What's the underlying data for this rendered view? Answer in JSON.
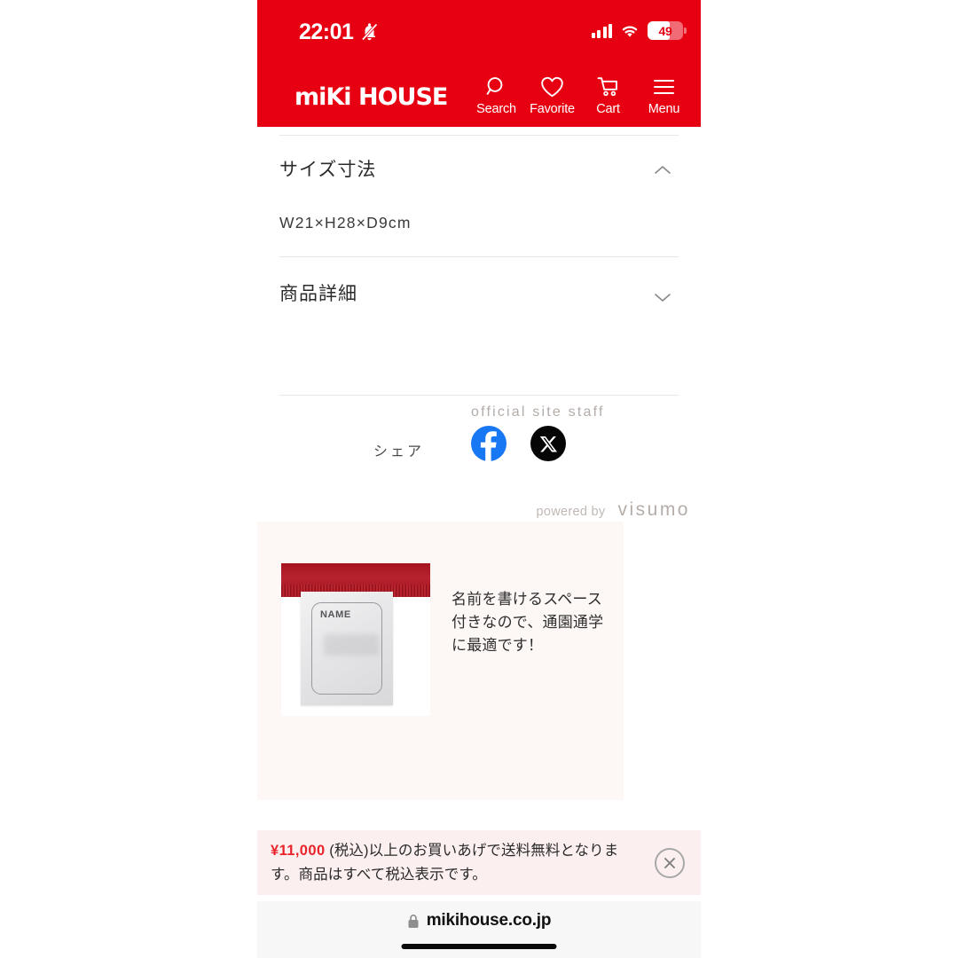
{
  "statusbar": {
    "time": "22:01",
    "battery_percent": "49",
    "icons": [
      "bell-slash-icon",
      "cellular-signal-icon",
      "wifi-icon",
      "battery-icon"
    ]
  },
  "header": {
    "logo_text": "miKi HOUSE",
    "brand_color": "#E60012",
    "nav": [
      {
        "label": "Search",
        "icon": "search-icon"
      },
      {
        "label": "Favorite",
        "icon": "heart-icon"
      },
      {
        "label": "Cart",
        "icon": "cart-icon"
      },
      {
        "label": "Menu",
        "icon": "hamburger-menu-icon"
      }
    ]
  },
  "accordions": [
    {
      "title": "サイズ寸法",
      "expanded": true,
      "chevron": "chevron-up-icon",
      "body": "W21×H28×D9cm"
    },
    {
      "title": "商品詳細",
      "expanded": false,
      "chevron": "chevron-down-icon",
      "body": ""
    }
  ],
  "share": {
    "label": "シェア",
    "buttons": [
      {
        "name": "facebook-share-button",
        "icon": "facebook-icon",
        "color": "#1877F2"
      },
      {
        "name": "x-share-button",
        "icon": "x-twitter-icon",
        "color": "#050505"
      }
    ]
  },
  "visumo_card": {
    "background": "#FDF8F5",
    "photo_alt": "NAME",
    "photo_label": "NAME",
    "caption": "名前を書けるスペース付きなので、通園通学に最適です！",
    "author": "official site staff",
    "powered_by_label": "powered by",
    "powered_by_brand": "visumo"
  },
  "banner": {
    "price": "¥11,000",
    "text_rest": " (税込)以上のお買いあげで送料無料となります。商品はすべて税込表示です。",
    "background": "#FCEFEF",
    "price_color": "#E8232A",
    "close_icon": "close-circle-icon"
  },
  "browser": {
    "host": "mikihouse.co.jp",
    "lock_icon": "lock-icon"
  }
}
